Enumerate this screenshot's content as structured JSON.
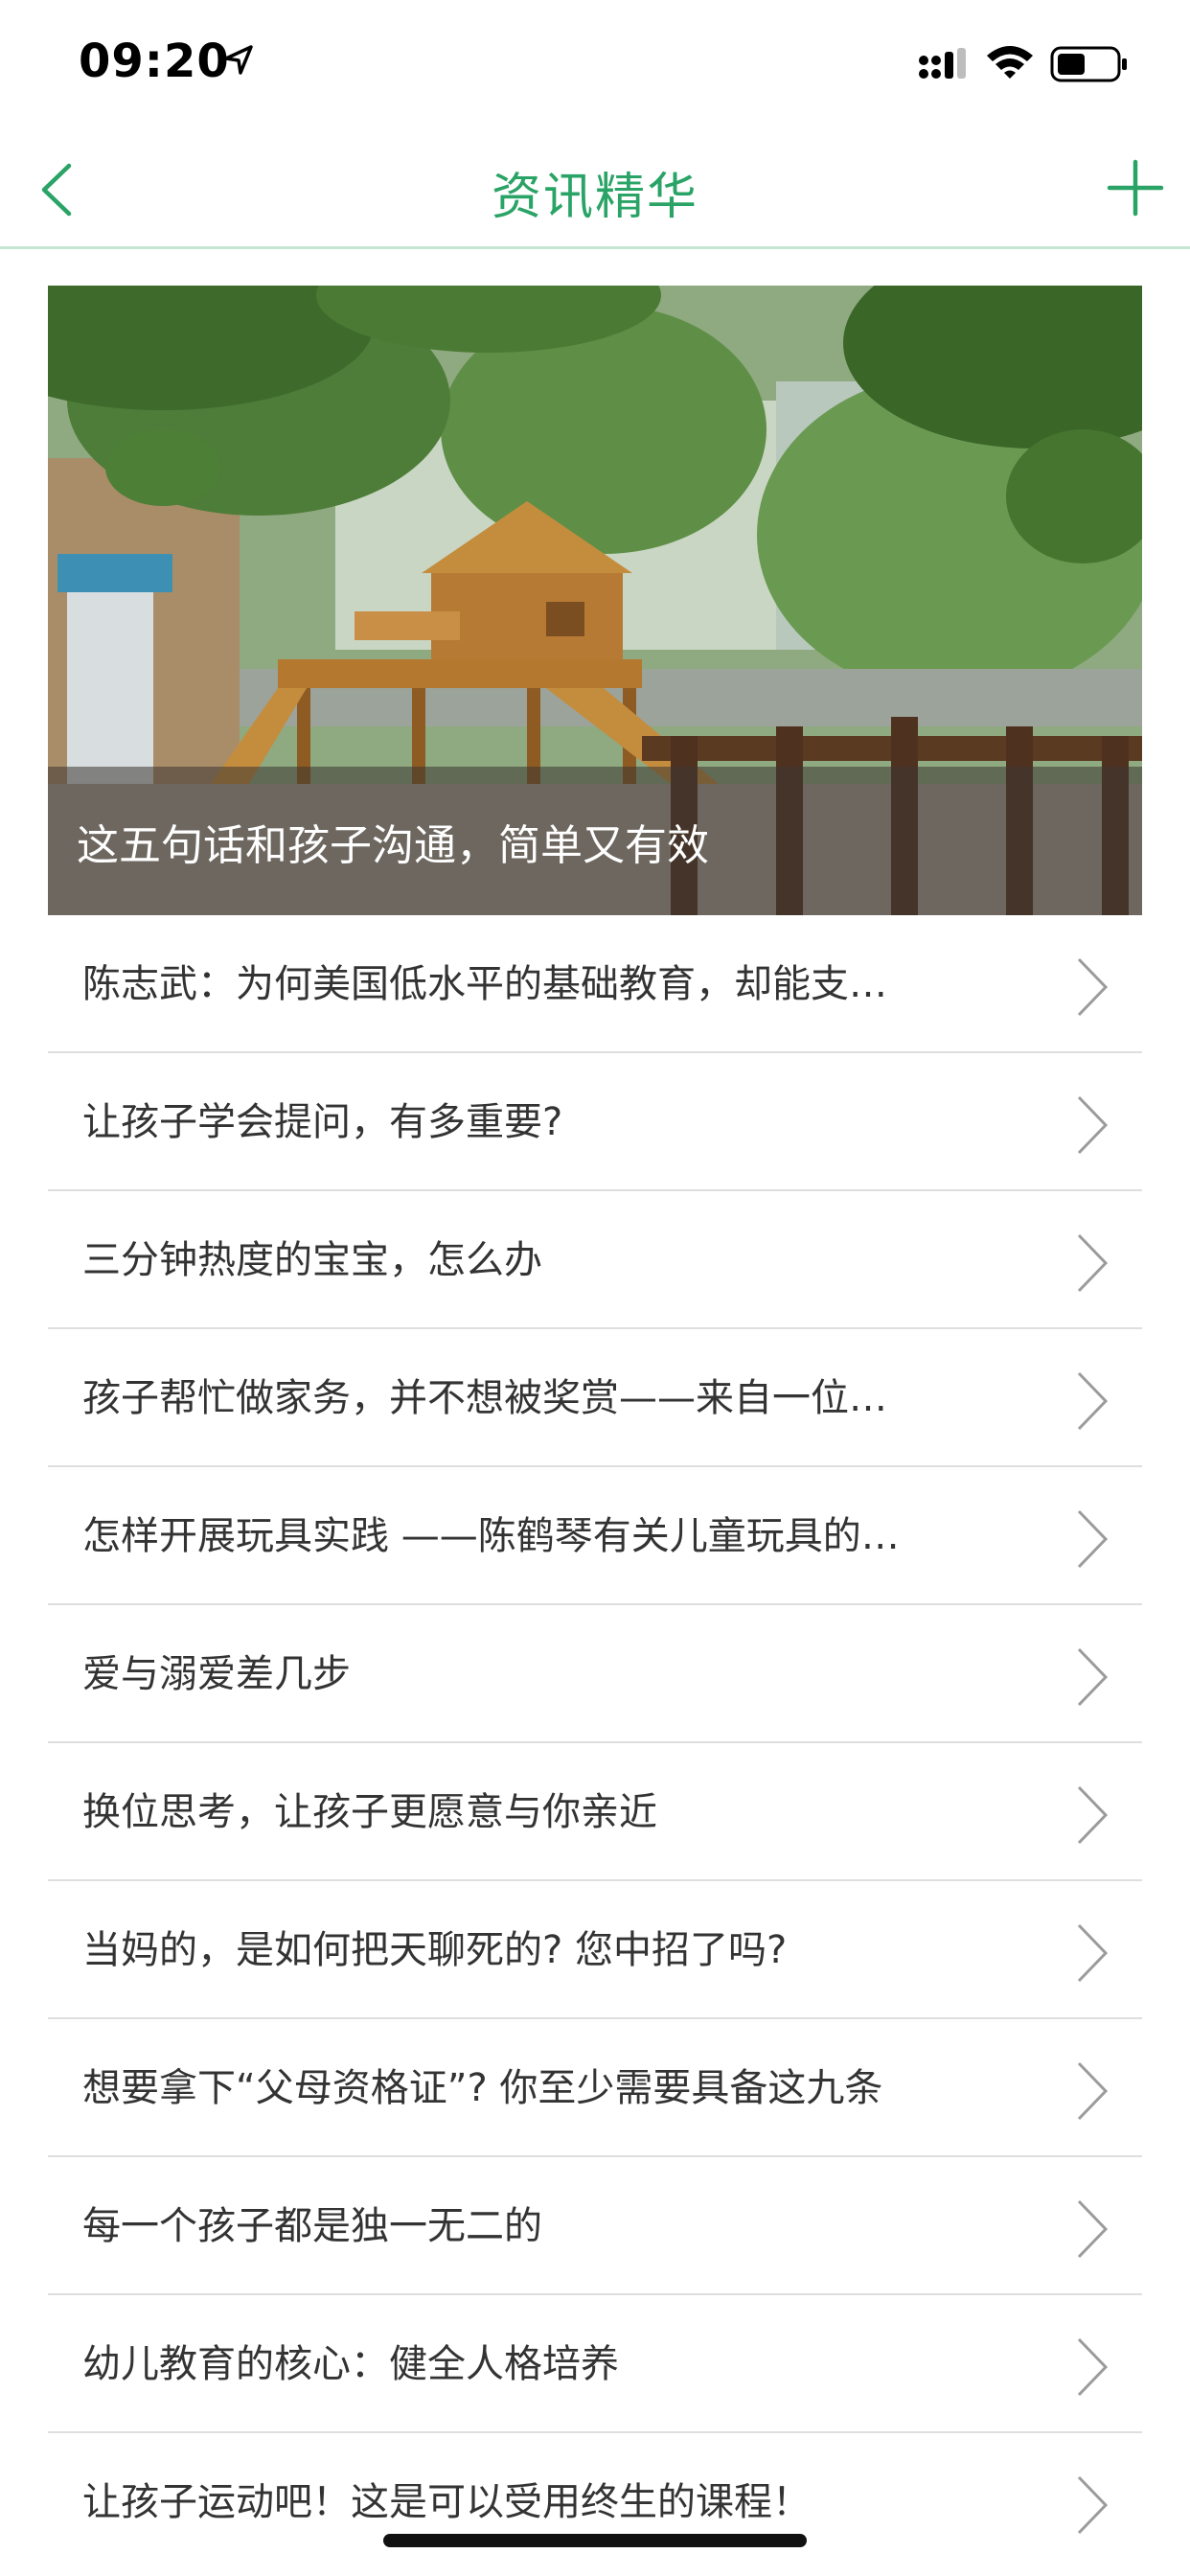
{
  "status_bar": {
    "time": "09:20"
  },
  "nav": {
    "title": "资讯精华",
    "accent_color": "#2aa366"
  },
  "banner": {
    "caption": "这五句话和孩子沟通，简单又有效"
  },
  "news_items": [
    "陈志武：为何美国低水平的基础教育，却能支…",
    "让孩子学会提问，有多重要?",
    "三分钟热度的宝宝，怎么办",
    "孩子帮忙做家务，并不想被奖赏——来自一位…",
    "怎样开展玩具实践 ——陈鹤琴有关儿童玩具的…",
    "爱与溺爱差几步",
    "换位思考，让孩子更愿意与你亲近",
    "当妈的，是如何把天聊死的? 您中招了吗?",
    "想要拿下“父母资格证”? 你至少需要具备这九条",
    "每一个孩子都是独一无二的",
    "幼儿教育的核心：健全人格培养",
    "让孩子运动吧！这是可以受用终生的课程！"
  ]
}
